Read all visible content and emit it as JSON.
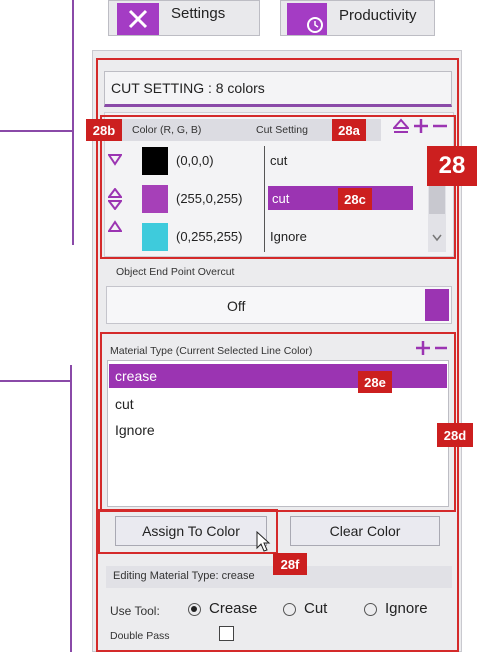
{
  "tabs": {
    "settings": "Settings",
    "productivity": "Productivity"
  },
  "cut_setting": {
    "header": "CUT SETTING : 8 colors",
    "col_color": "Color (R, G, B)",
    "col_cut": "Cut Setting",
    "rows": [
      {
        "rgb": "(0,0,0)",
        "swatch": "#000000",
        "setting": "cut"
      },
      {
        "rgb": "(255,0,255)",
        "swatch": "#a640b8",
        "setting": "cut"
      },
      {
        "rgb": "(0,255,255)",
        "swatch": "#3ecbdc",
        "setting": "Ignore"
      }
    ]
  },
  "overcut": {
    "label": "Object End Point Overcut",
    "value": "Off"
  },
  "material": {
    "label": "Material Type (Current Selected Line Color)",
    "items": [
      "crease",
      "cut",
      "Ignore"
    ]
  },
  "buttons": {
    "assign": "Assign To Color",
    "clear": "Clear Color"
  },
  "editing": {
    "label": "Editing Material Type: crease",
    "use_tool": "Use Tool:",
    "tools": [
      "Crease",
      "Cut",
      "Ignore"
    ],
    "double_pass": "Double Pass"
  },
  "callouts": {
    "c28": "28",
    "c28a": "28a",
    "c28b": "28b",
    "c28c": "28c",
    "c28d": "28d",
    "c28e": "28e",
    "c28f": "28f"
  },
  "colors": {
    "accent": "#9b34b2",
    "callout": "#cc1f1f"
  }
}
